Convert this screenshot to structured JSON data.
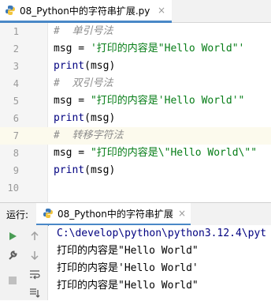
{
  "editor_tab": {
    "title": "08_Python中的字符串扩展.py",
    "close": "×"
  },
  "lines": [
    {
      "num": "1",
      "comment": "#  单引号法"
    },
    {
      "num": "2",
      "code": "msg = ",
      "str": "'打印的内容是\"Hello World\"'"
    },
    {
      "num": "3",
      "fn": "print",
      "rest": "(msg)"
    },
    {
      "num": "4",
      "comment": "#  双引号法"
    },
    {
      "num": "5",
      "code": "msg = ",
      "str": "\"打印的内容是'Hello World'\""
    },
    {
      "num": "6",
      "fn": "print",
      "rest": "(msg)"
    },
    {
      "num": "7",
      "comment": "#  转移字符法"
    },
    {
      "num": "8",
      "code": "msg = ",
      "str": "\"打印的内容是\\\"Hello World\\\"\""
    },
    {
      "num": "9",
      "fn": "print",
      "rest": "(msg)"
    },
    {
      "num": "10"
    }
  ],
  "run_panel": {
    "label": "运行:",
    "tab_title": "08_Python中的字符串扩展",
    "close": "×",
    "output": [
      "C:\\develop\\python\\python3.12.4\\pyt",
      "打印的内容是\"Hello World\"",
      "打印的内容是'Hello World'",
      "打印的内容是\"Hello World\""
    ]
  },
  "colors": {
    "accent": "#4a88c7",
    "run_green": "#499c54",
    "string": "#067d17",
    "comment": "#8c8c8c"
  }
}
